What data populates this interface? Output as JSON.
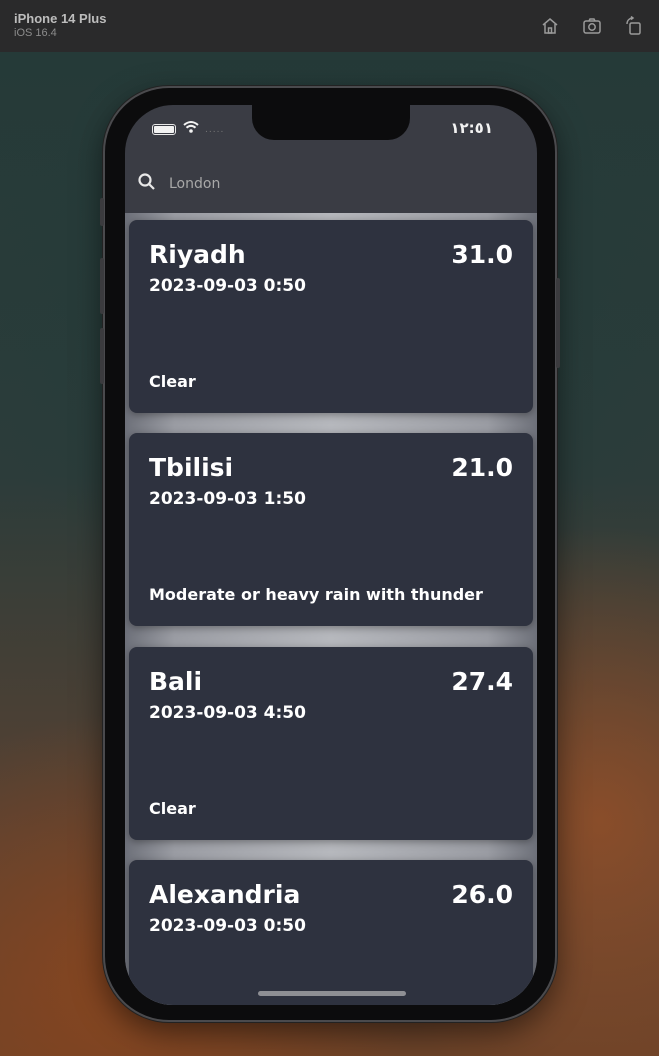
{
  "simulator": {
    "device_name": "iPhone 14 Plus",
    "os_version": "iOS 16.4",
    "tools": [
      "home-icon",
      "screenshot-icon",
      "rotate-icon"
    ]
  },
  "status_bar": {
    "time": "١٢:٥١",
    "signal": "....."
  },
  "search": {
    "placeholder": "London",
    "value": ""
  },
  "cards": [
    {
      "city": "Riyadh",
      "temp": "31.0",
      "time": "2023-09-03 0:50",
      "condition": "Clear"
    },
    {
      "city": "Tbilisi",
      "temp": "21.0",
      "time": "2023-09-03 1:50",
      "condition": "Moderate or heavy rain with thunder"
    },
    {
      "city": "Bali",
      "temp": "27.4",
      "time": "2023-09-03 4:50",
      "condition": "Clear"
    },
    {
      "city": "Alexandria",
      "temp": "26.0",
      "time": "2023-09-03 0:50",
      "condition": ""
    }
  ],
  "colors": {
    "card_bg": "#2e323f",
    "screen_bg": "#3a3c44",
    "text": "#ffffff"
  }
}
